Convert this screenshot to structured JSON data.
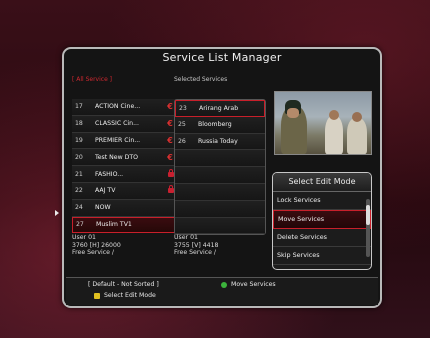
{
  "title": "Service List Manager",
  "headers": {
    "all_service": "[ All Service ]",
    "selected_services": "Selected Services"
  },
  "left_list": [
    {
      "num": "17",
      "name": "ACTION Cine...",
      "mark": "€"
    },
    {
      "num": "18",
      "name": "CLASSIC Cin...",
      "mark": "€"
    },
    {
      "num": "19",
      "name": "PREMIER Cin...",
      "mark": "€"
    },
    {
      "num": "20",
      "name": "Test New DTO",
      "mark": "€"
    },
    {
      "num": "21",
      "name": "FASHIO...",
      "mark": "lock"
    },
    {
      "num": "22",
      "name": "AAJ TV",
      "mark": "lock"
    },
    {
      "num": "24",
      "name": "NOW",
      "mark": ""
    },
    {
      "num": "27",
      "name": "Muslim TV1",
      "mark": ""
    }
  ],
  "right_list": [
    {
      "num": "23",
      "name": "Arirang Arab"
    },
    {
      "num": "25",
      "name": "Bloomberg"
    },
    {
      "num": "26",
      "name": "Russia Today"
    },
    {
      "num": "",
      "name": ""
    },
    {
      "num": "",
      "name": ""
    },
    {
      "num": "",
      "name": ""
    },
    {
      "num": "",
      "name": ""
    },
    {
      "num": "",
      "name": ""
    }
  ],
  "left_info": {
    "line1": "User 01",
    "line2": "3760 [H] 26000",
    "line3": "Free Service /"
  },
  "right_info": {
    "line1": "User 01",
    "line2": "3755 [V] 4418",
    "line3": "Free Service /"
  },
  "edit_mode": {
    "title": "Select Edit Mode",
    "items": [
      "Lock Services",
      "Move Services",
      "Delete Services",
      "Skip Services"
    ],
    "selected_index": 1
  },
  "footer": {
    "sort_status": "[ Default - Not Sorted ]",
    "green_action": "Move Services",
    "yellow_action": "Select Edit Mode",
    "green_color": "#3cb43c",
    "yellow_color": "#e0c020"
  },
  "colors": {
    "accent": "#c81f2a"
  }
}
